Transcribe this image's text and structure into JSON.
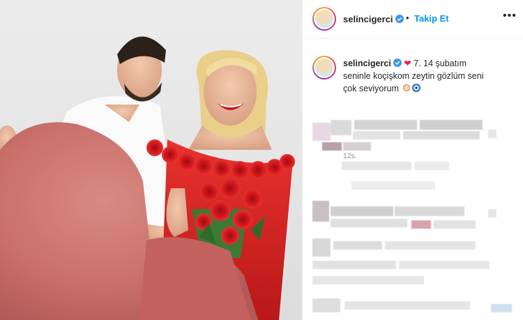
{
  "post": {
    "username": "selincigerci",
    "follow_label": "Takip Et",
    "separator": "•",
    "more_label": "•••"
  },
  "caption": {
    "username": "selincigerci",
    "text_line1": "7. 14 şubatım",
    "text_line2": "seninle koçişkom zeytin gözlüm seni",
    "text_line3": "çok seviyorum",
    "time": "12s."
  },
  "colors": {
    "accent": "#0095f6",
    "text": "#262626",
    "muted": "#8e8e8e",
    "heart": "#e0245e"
  },
  "icons": {
    "verified": "verified-badge-icon",
    "heart": "red-heart-icon",
    "more": "more-options-icon"
  }
}
